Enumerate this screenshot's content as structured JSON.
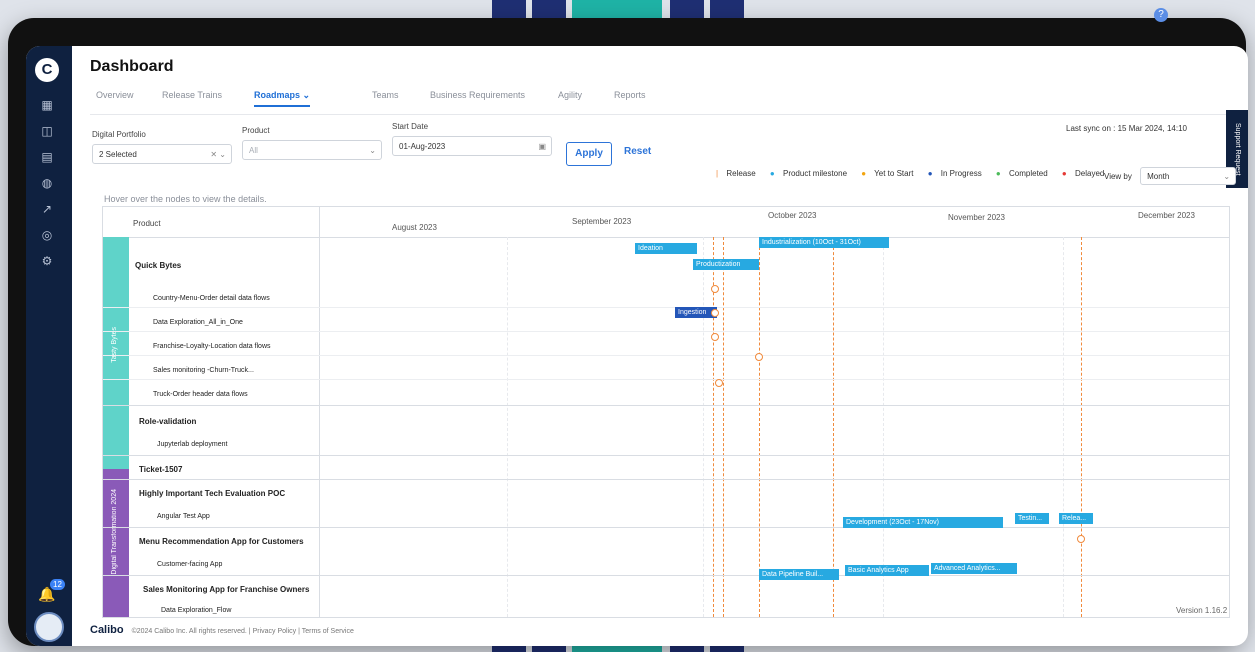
{
  "page": {
    "title": "Dashboard"
  },
  "tabs": [
    {
      "label": "Overview"
    },
    {
      "label": "Release Trains"
    },
    {
      "label": "Roadmaps"
    },
    {
      "label": "Teams"
    },
    {
      "label": "Business Requirements"
    },
    {
      "label": "Agility"
    },
    {
      "label": "Reports"
    }
  ],
  "filters": {
    "portfolio_label": "Digital Portfolio",
    "portfolio_value": "2 Selected",
    "product_label": "Product",
    "product_placeholder": "All",
    "start_label": "Start Date",
    "start_value": "01-Aug-2023",
    "apply": "Apply",
    "reset": "Reset"
  },
  "last_sync": "Last sync on : 15 Mar 2024, 14:10",
  "support_request": "Support Request",
  "legend": {
    "release": "Release",
    "product_milestone": "Product milestone",
    "yet_to_start": "Yet to Start",
    "in_progress": "In Progress",
    "completed": "Completed",
    "delayed": "Delayed"
  },
  "colors": {
    "release": "#f08a3c",
    "milestone": "#27a9e1",
    "yet": "#f2a40f",
    "progress": "#2356b8",
    "completed": "#4cbb5a",
    "delayed": "#e53935"
  },
  "view_by": {
    "label": "View by",
    "value": "Month"
  },
  "hover_note": "Hover over the nodes to view the details.",
  "grid": {
    "product_header": "Product",
    "months": [
      "August 2023",
      "September 2023",
      "October 2023",
      "November 2023",
      "December 2023"
    ],
    "groups": [
      {
        "name": "Tasty Bytes",
        "color": "#5fd3c9"
      },
      {
        "name": "Digital Transformation 2024",
        "color": "#8a5ab8"
      }
    ],
    "rows": [
      {
        "label": "Quick Bytes",
        "bold": true
      },
      {
        "label": "Country-Menu-Order detail data flows"
      },
      {
        "label": "Data Exploration_All_in_One"
      },
      {
        "label": "Franchise-Loyalty-Location data flows"
      },
      {
        "label": "Sales monitoring -Churn-Truck..."
      },
      {
        "label": "Truck-Order header data flows"
      },
      {
        "label": "Role-validation",
        "bold": true
      },
      {
        "label": "Jupyterlab deployment"
      },
      {
        "label": "Ticket-1507",
        "bold": true
      },
      {
        "label": "Highly Important Tech Evaluation POC",
        "bold": true
      },
      {
        "label": "Angular Test App"
      },
      {
        "label": "Menu Recommendation App for Customers",
        "bold": true
      },
      {
        "label": "Customer-facing App"
      },
      {
        "label": "Sales Monitoring App for Franchise Owners",
        "bold": true
      },
      {
        "label": "Data Exploration_Flow"
      }
    ],
    "bars": [
      {
        "label": "Ideation"
      },
      {
        "label": "Productization"
      },
      {
        "label": "Industrialization (10Oct - 31Oct)"
      },
      {
        "label": "Ingestion"
      },
      {
        "label": "Development (23Oct - 17Nov)"
      },
      {
        "label": "Testin..."
      },
      {
        "label": "Relea..."
      },
      {
        "label": "Data Pipeline Buil..."
      },
      {
        "label": "Basic Analytics App"
      },
      {
        "label": "Advanced Analytics..."
      }
    ]
  },
  "footer": {
    "brand": "Calibo",
    "copyright": "©2024 Calibo Inc. All rights reserved.",
    "privacy": "Privacy Policy",
    "terms": "Terms of Service"
  },
  "version": "Version 1.16.2",
  "notifications": {
    "count": "12"
  }
}
